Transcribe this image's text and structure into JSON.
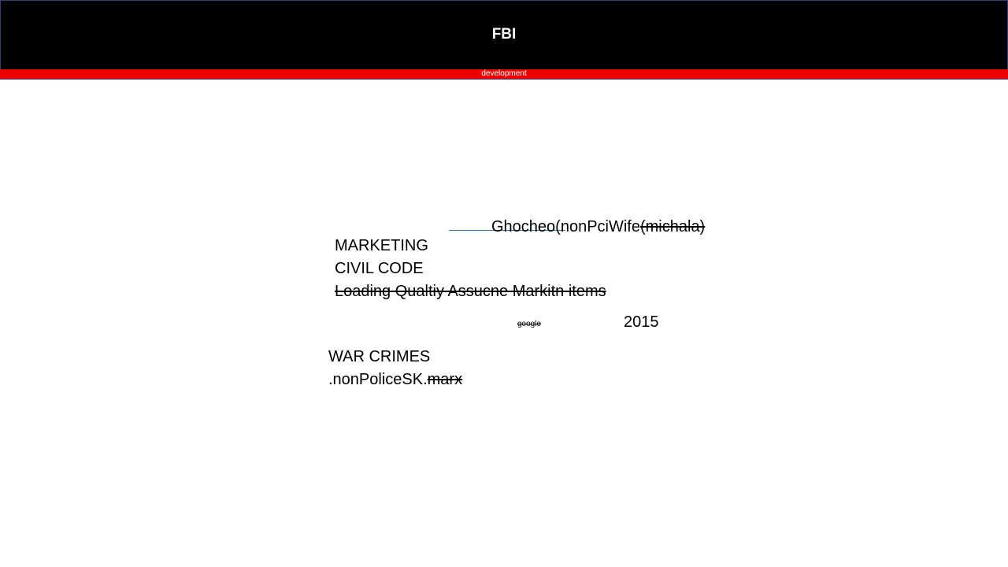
{
  "header": {
    "title": "FBI",
    "subtitle": "development",
    "bar_color": "#000000",
    "accent_color": "#ee0000"
  },
  "body": {
    "line1_main": "Ghocheo(nonPciWife",
    "line1_struck": "(michala)",
    "marketing": "MARKETING",
    "civil_code": "CIVIL CODE",
    "loading_struck": "Loading Qualtiy Assucne Markitn items",
    "google_struck": "google",
    "year": "2015",
    "war_crimes": "WAR CRIMES",
    "nonpolice_main": ".nonPoliceSK.",
    "nonpolice_struck": "marx"
  }
}
